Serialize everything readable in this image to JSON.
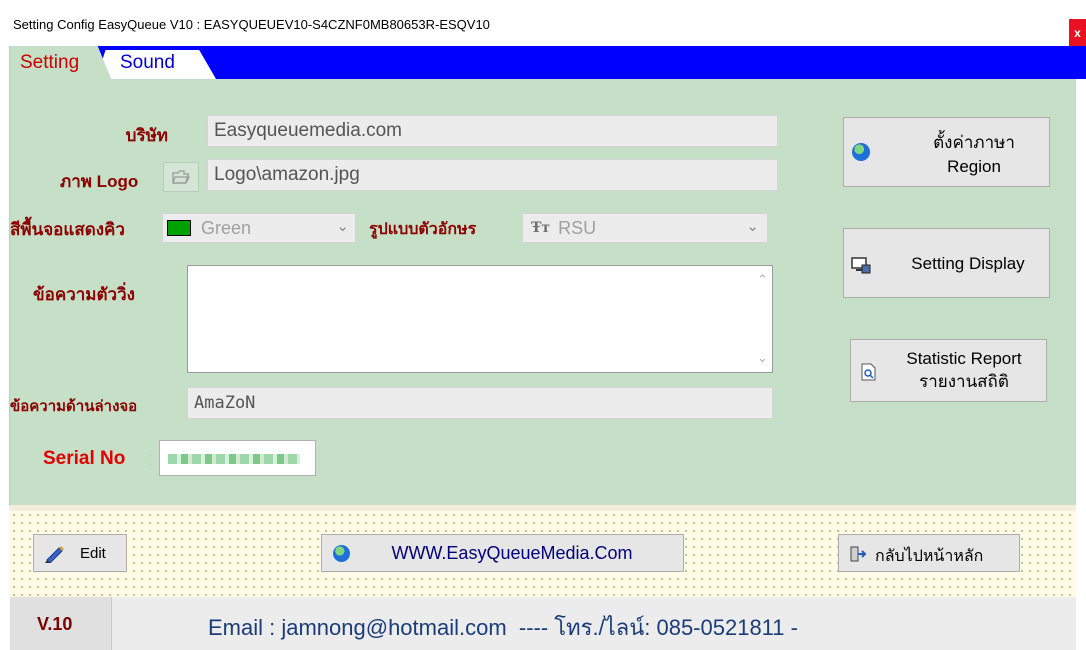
{
  "window": {
    "title": "Setting Config EasyQueue V10 : EASYQUEUEV10-S4CZNF0MB80653R-ESQV10",
    "close_label": "x"
  },
  "tabs": [
    {
      "label": "Setting",
      "active": true
    },
    {
      "label": "Sound",
      "active": false
    }
  ],
  "form": {
    "company_label": "บริษัท",
    "company_value": "Easyqueuemedia.com",
    "logo_label": "ภาพ Logo",
    "logo_value": "Logo\\amazon.jpg",
    "bgcolor_label": "สีพื้นจอแสดงคิว",
    "bgcolor_value": "Green",
    "bgcolor_swatch": "#00a000",
    "font_label": "รูปแบบตัวอักษร",
    "font_value": "RSU",
    "marquee_label": "ข้อความตัววิ่ง",
    "marquee_value": "",
    "footer_text_label": "ข้อความด้านล่างจอ",
    "footer_text_value": "AmaZoN",
    "serial_label": "Serial No",
    "serial_sep": ":"
  },
  "side_buttons": {
    "region_line1": "ตั้งค่าภาษา",
    "region_line2": "Region",
    "display": "Setting Display",
    "report_line1": "Statistic Report",
    "report_line2": "รายงานสถิติ"
  },
  "bottom_buttons": {
    "edit": "Edit",
    "website": "WWW.EasyQueueMedia.Com",
    "home": "กลับไปหน้าหลัก"
  },
  "status": {
    "version": "V.10",
    "contact": "Email : jamnong@hotmail.com  ---- โทร./ไลน์: 085-0521811 -"
  },
  "colors": {
    "panel": "#c6dfc7",
    "tab_strip": "#0000ff",
    "label": "#8b0000",
    "serial_label": "#e00000",
    "contact_text": "#1a3d7a"
  }
}
